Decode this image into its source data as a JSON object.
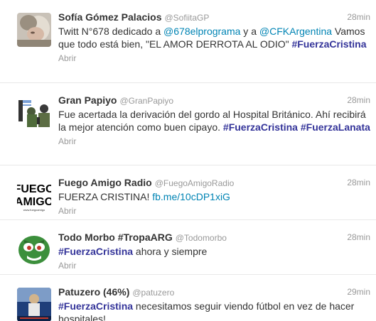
{
  "tweets": [
    {
      "fullname": "Sofía Gómez Palacios",
      "username": "@SofiitaGP",
      "time": "28min",
      "text_parts": [
        "Twitt N°678 dedicado a ",
        "@678elprograma",
        " y a ",
        "@CFKArgentina",
        " Vamos que todo está bien, \"EL AMOR DERROTA AL ODIO\" ",
        "#FuerzaCristina"
      ],
      "expand": "Abrir"
    },
    {
      "fullname": "Gran Papiyo",
      "username": "@GranPapiyo",
      "time": "28min",
      "text_parts": [
        "Fue acertada la derivación del gordo al Hospital Británico. Ahí recibirá la mejor atención como buen cipayo. ",
        "#FuerzaCristina",
        " ",
        "#FuerzaLanata"
      ],
      "expand": "Abrir"
    },
    {
      "fullname": "Fuego Amigo Radio",
      "username": "@FuegoAmigoRadio",
      "time": "28min",
      "text_parts": [
        "FUERZA CRISTINA! ",
        "fb.me/10cDP1xiG"
      ],
      "avatar_text": [
        "FUEGO",
        "AMIGO",
        "www.fuegoamigo"
      ],
      "expand": "Abrir"
    },
    {
      "fullname": "Todo Morbo #TropaARG",
      "username": "@Todomorbo",
      "time": "28min",
      "text_parts": [
        "#FuerzaCristina",
        " ahora y siempre"
      ],
      "expand": "Abrir"
    },
    {
      "fullname": "Patuzero (46%)",
      "username": "@patuzero",
      "time": "29min",
      "text_parts": [
        "#FuerzaCristina",
        " necesitamos seguir viendo fútbol en vez de hacer hospitales!"
      ]
    }
  ],
  "colors": {
    "mention": "#0084b4",
    "hashtag": "#333399",
    "muted": "#999999",
    "text": "#333333"
  }
}
